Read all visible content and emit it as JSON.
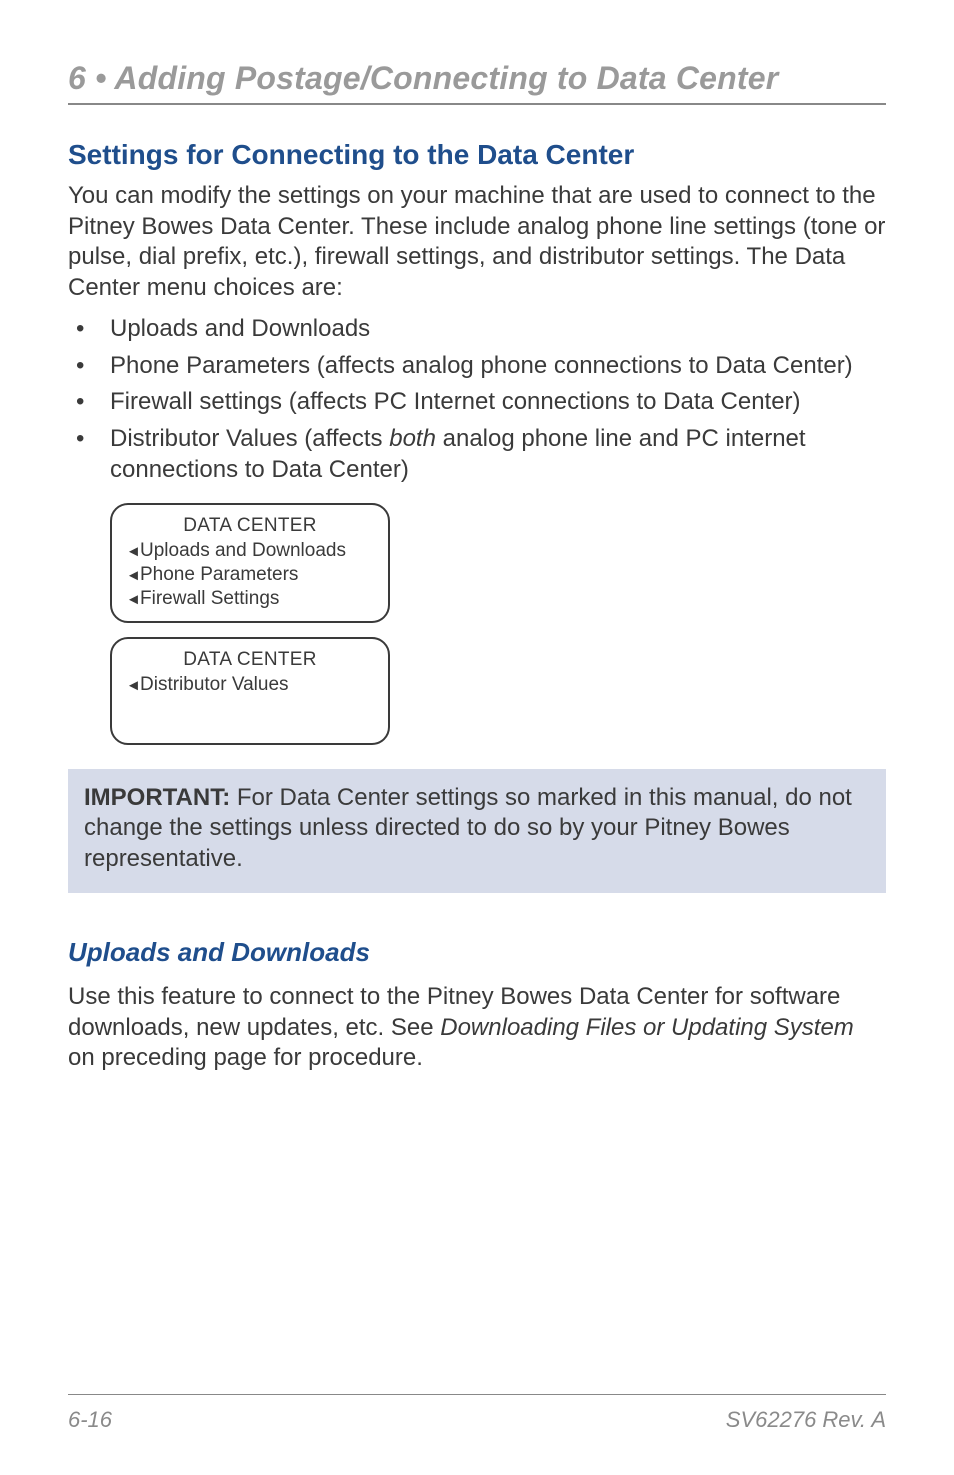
{
  "chapter": {
    "title": "6 • Adding Postage/Connecting to Data Center"
  },
  "section": {
    "title": "Settings for Connecting to the Data Center",
    "intro": "You can modify the settings on your machine that are used to connect to the Pitney Bowes Data Center. These include analog phone line settings (tone or pulse, dial prefix, etc.), firewall settings, and distributor settings. The Data Center menu choices are:"
  },
  "bullets": [
    {
      "text": "Uploads and Downloads"
    },
    {
      "text": "Phone Parameters (affects analog phone connections to Data Center)"
    },
    {
      "text": "Firewall settings (affects PC Internet connections to Data Center)"
    },
    {
      "pre": "Distributor Values (affects ",
      "em": "both",
      "post": " analog phone line and PC internet connections to Data Center)"
    }
  ],
  "screens": [
    {
      "title": "DATA CENTER",
      "items": [
        "Uploads and Downloads",
        "Phone Parameters",
        "Firewall Settings"
      ]
    },
    {
      "title": "DATA CENTER",
      "items": [
        "Distributor Values"
      ]
    }
  ],
  "callout": {
    "label": "IMPORTANT:",
    "text": " For Data Center settings so marked in this manual, do not change the settings unless directed to do so by your Pitney Bowes representative."
  },
  "sub": {
    "title": "Uploads and Downloads",
    "text_pre": "Use this feature to connect to the Pitney Bowes Data Center for software downloads, new updates, etc. See ",
    "text_em": "Downloading Files or Updating System",
    "text_post": " on preceding page for procedure."
  },
  "footer": {
    "page": "6-16",
    "doc": "SV62276 Rev. A"
  }
}
